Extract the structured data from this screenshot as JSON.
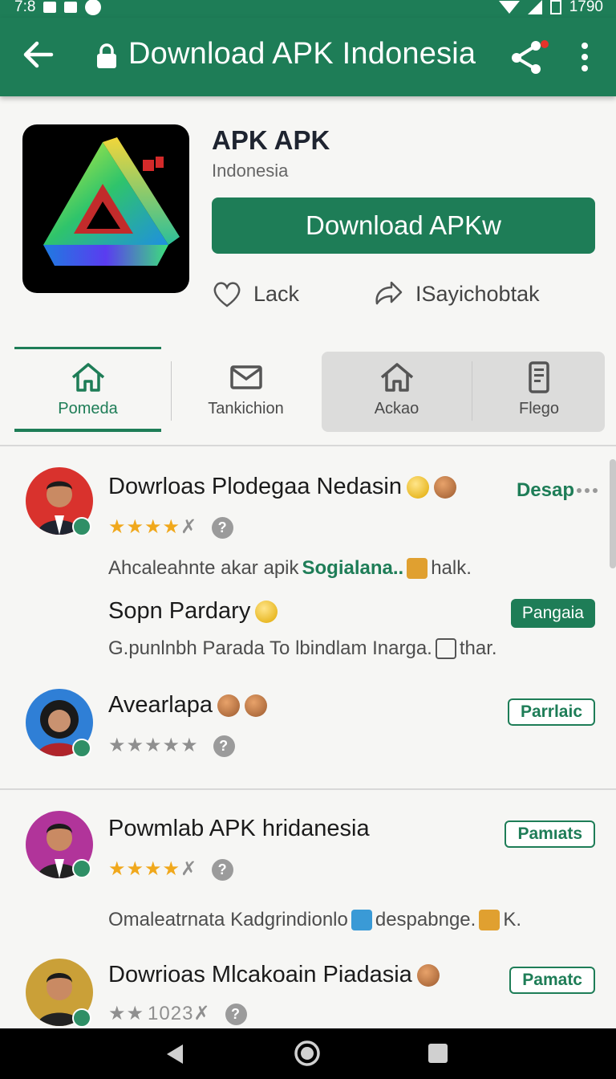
{
  "status_bar": {
    "time": "7:8",
    "battery_text": "1790"
  },
  "app_bar": {
    "title": "Download APK Indonesia"
  },
  "app": {
    "name": "APK APK",
    "region": "Indonesia",
    "download_label": "Download APKw",
    "like_label": "Lack",
    "share_label": "ISayichobtak"
  },
  "tabs": [
    {
      "label": "Pomeda",
      "icon": "home-icon",
      "active": true
    },
    {
      "label": "Tankichion",
      "icon": "mail-icon",
      "active": false
    },
    {
      "label": "Ackao",
      "icon": "home-icon",
      "active": false
    },
    {
      "label": "Flego",
      "icon": "phone-icon",
      "active": false
    }
  ],
  "reviews": [
    {
      "title": "Dowrloas Plodegaa Nedasin",
      "stars": "★★★★",
      "stars_off": "✗",
      "tag": "Desap",
      "text_a": "Ahcaleahnte akar apik",
      "text_hl": "Sogialana..",
      "text_b": "halk.",
      "sub_title": "Sopn Pardary",
      "sub_badge": "Pangaia",
      "sub_text_a": "G.punlnbh Parada To lbindlam Inarga.",
      "sub_text_b": "thar."
    },
    {
      "title": "Avearlapa",
      "stars_off": "★★★★★",
      "badge": "Parrlaic"
    },
    {
      "title": "Powmlab APK hridanesia",
      "stars": "★★★★",
      "stars_off": "✗",
      "badge": "Pamıats",
      "text_a": "Omaleatrnata Kadgrindionlo",
      "text_b": "despabnge.",
      "text_c": "K."
    },
    {
      "title": "Dowrioas Mlcakoain Piadasia",
      "stars_off": "★★",
      "count": "1023✗",
      "badge": "Pamatc"
    }
  ],
  "help_glyph": "?",
  "colors": {
    "brand_green": "#1e7d57",
    "star_gold": "#f0a81c"
  }
}
